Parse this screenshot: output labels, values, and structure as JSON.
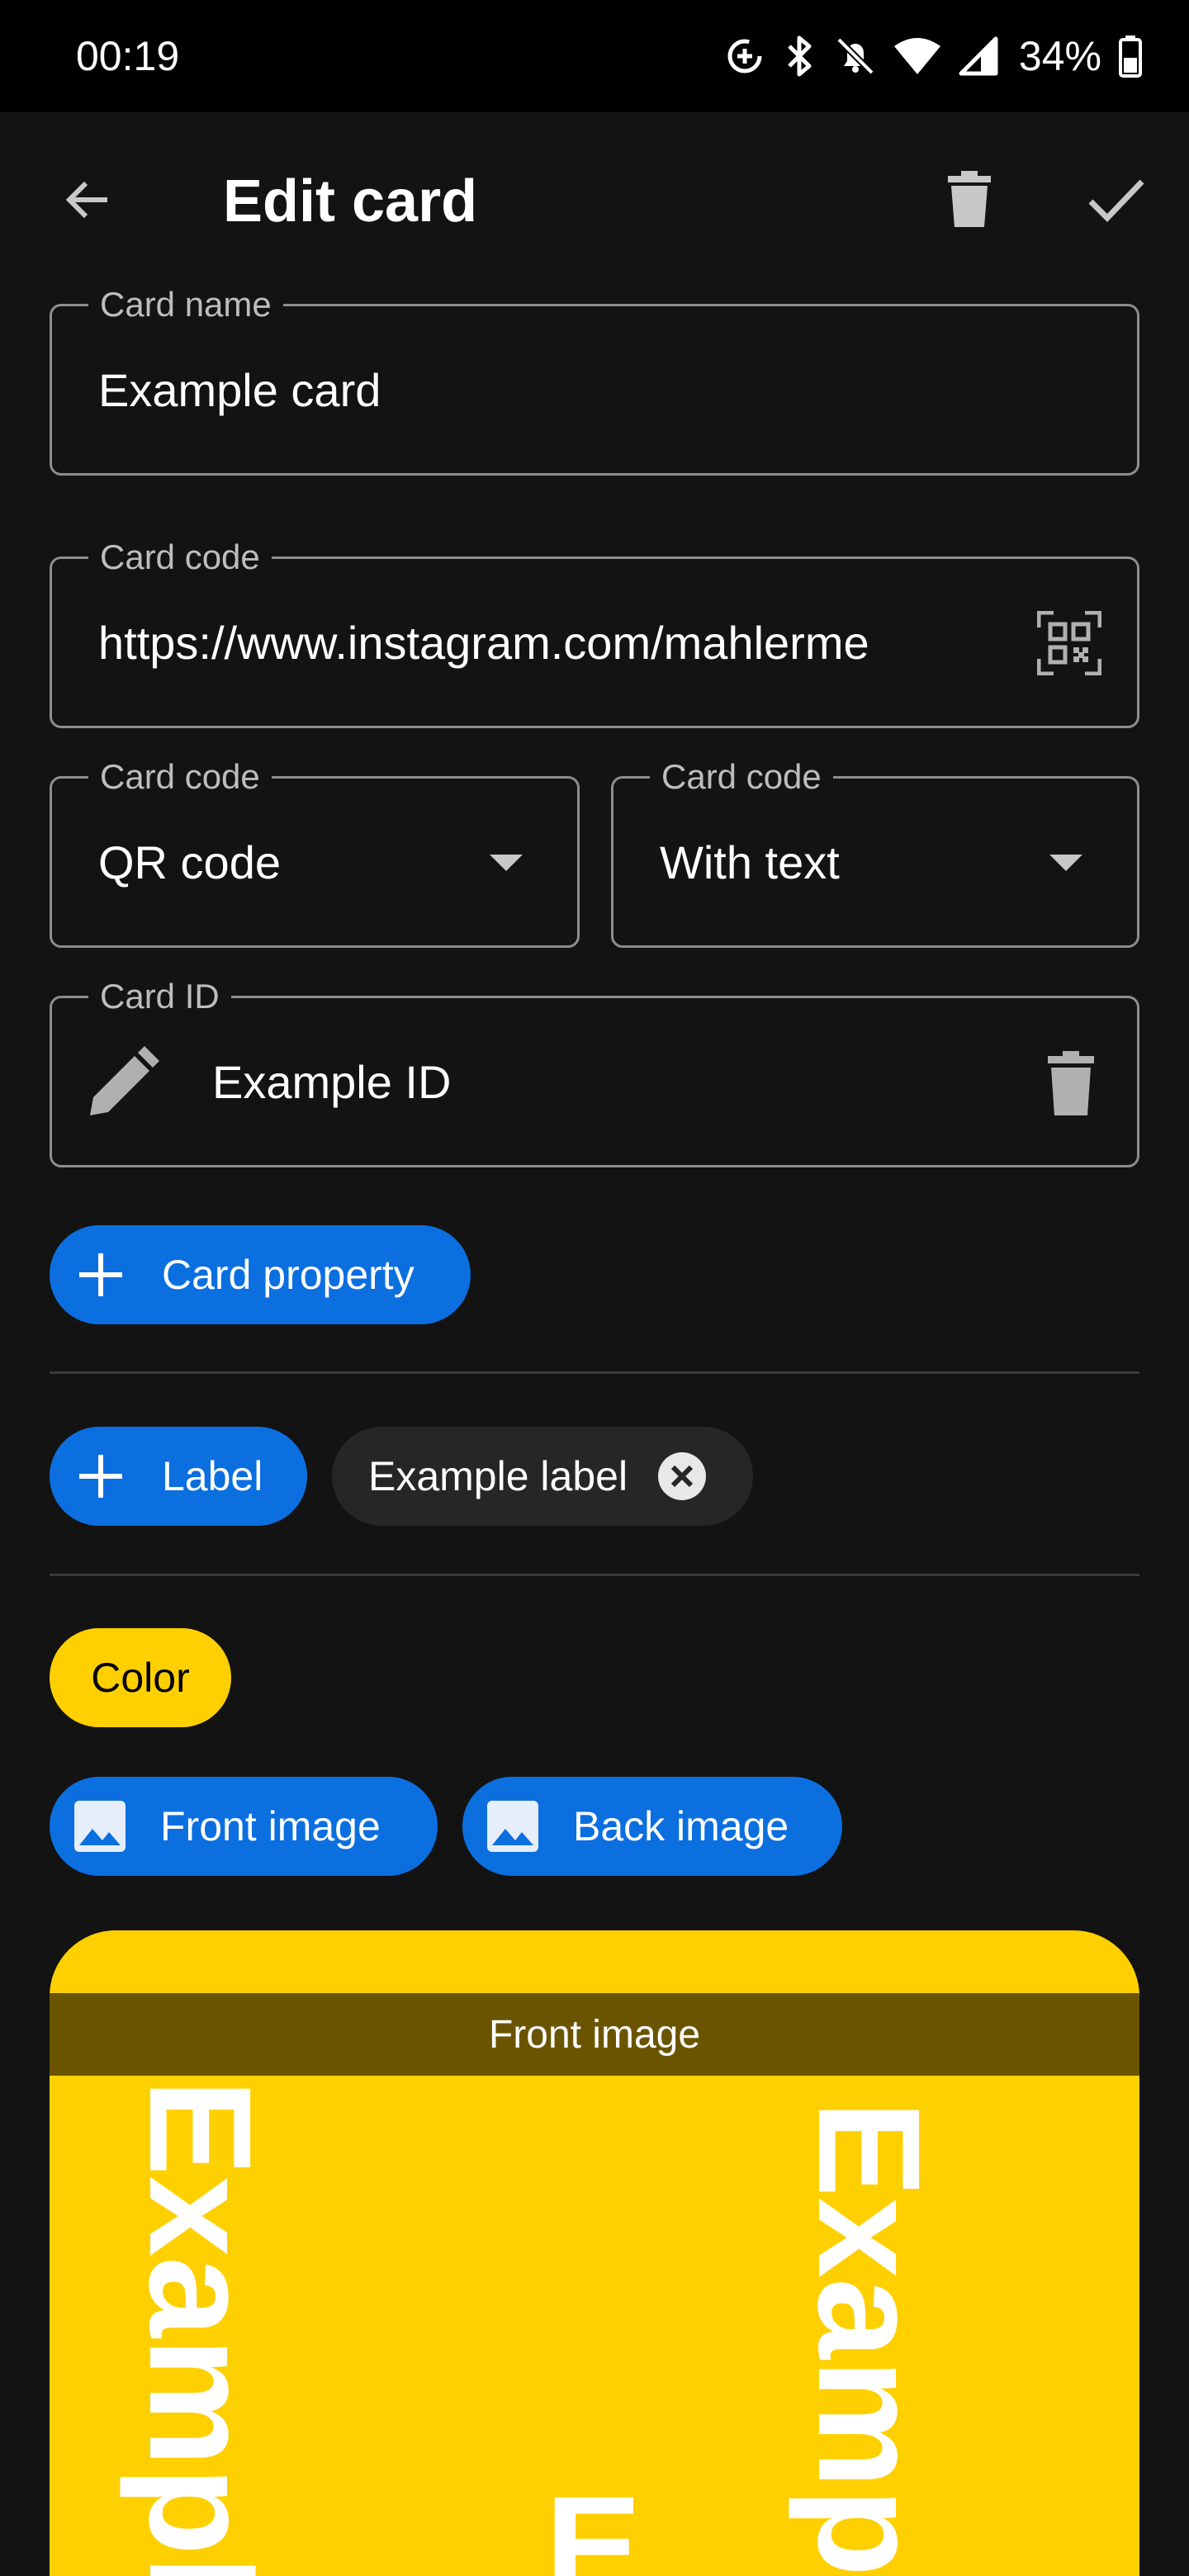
{
  "status_bar": {
    "time": "00:19",
    "battery_percent": "34%",
    "icons": [
      "data-saver-icon",
      "bluetooth-icon",
      "bell-off-icon",
      "wifi-icon",
      "signal-icon",
      "battery-icon"
    ]
  },
  "app_bar": {
    "title": "Edit card",
    "back_icon": "arrow-back-icon",
    "delete_icon": "trash-icon",
    "save_icon": "check-icon"
  },
  "form": {
    "card_name": {
      "label": "Card name",
      "value": "Example card"
    },
    "card_code": {
      "label": "Card code",
      "value": "https://www.instagram.com/mahlerme",
      "scan_icon": "qr-scan-icon"
    },
    "barcode_type": {
      "label": "Card code",
      "selected": "QR code"
    },
    "barcode_text": {
      "label": "Card code",
      "selected": "With text"
    },
    "card_id": {
      "label": "Card ID",
      "value": "Example ID",
      "edit_icon": "pencil-icon",
      "delete_icon": "trash-icon"
    }
  },
  "chips": {
    "card_property": "Card property",
    "label_add": "Label",
    "example_label": "Example label",
    "color": "Color",
    "front_image": "Front image",
    "back_image": "Back image"
  },
  "preview": {
    "banner": "Front image",
    "text_left": "Example",
    "text_right": "Example",
    "text_bottom": "E",
    "background_color": "#ffd000"
  },
  "colors": {
    "accent": "#0b6fe0",
    "card_yellow": "#ffd000",
    "background": "#131313"
  }
}
